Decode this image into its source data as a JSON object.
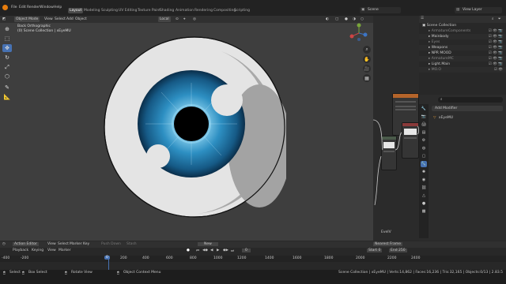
{
  "topbar": {
    "menus": [
      "File",
      "Edit",
      "Render",
      "Window",
      "Help"
    ],
    "workspaces": [
      "Layout",
      "Modeling",
      "Sculpting",
      "UV Editing",
      "Texture Paint",
      "Shading",
      "Animation",
      "Rendering",
      "Compositing",
      "Scripting"
    ],
    "active_workspace": "Layout",
    "scene_label": "Scene",
    "view_layer_label": "View Layer"
  },
  "viewport": {
    "mode": "Object Mode",
    "menus": [
      "View",
      "Select",
      "Add",
      "Object"
    ],
    "orientation": "Local",
    "view_name": "Back Orthographic",
    "collection_label": "(0) Scene Collection | xEyeMU"
  },
  "node_editor": {
    "label": "EveIV"
  },
  "outliner": {
    "title": "Scene Collection",
    "rows": [
      "ArmatureComponents",
      "Mainbody",
      "Eyes",
      "Weapons",
      "NPR MOOD",
      "ArmatureMC",
      "Light.Main",
      "MO.O"
    ]
  },
  "properties": {
    "search_placeholder": "",
    "add_modifier": "Add Modifier",
    "object_name": "xEyeMU"
  },
  "timeline": {
    "editor": "Action Editor",
    "playback": "Playback",
    "keying": "Keying",
    "menus": [
      "View",
      "Select",
      "Marker",
      "Key"
    ],
    "view": "View",
    "marker": "Marker",
    "push_down": "Push Down",
    "stash": "Stash",
    "new_label": "New",
    "nearest_frame": "Nearest Frame",
    "start_label": "Start",
    "start_val": "0",
    "end_label": "End",
    "end_val": "250",
    "ruler": [
      "-400",
      "-200",
      "0",
      "200",
      "400",
      "600",
      "800",
      "1000",
      "1200",
      "1400",
      "1600",
      "1800",
      "2000",
      "2200",
      "2400"
    ],
    "current_frame": "0"
  },
  "statusbar": {
    "select": "Select",
    "box_select": "Box Select",
    "rotate_view": "Rotate View",
    "context_menu": "Object Context Menu",
    "stats": "Scene Collection | xEyeMU | Verts:14,862 | Faces:16,236 | Tris:32,165 | Objects:0/13 | 2.83.5"
  }
}
